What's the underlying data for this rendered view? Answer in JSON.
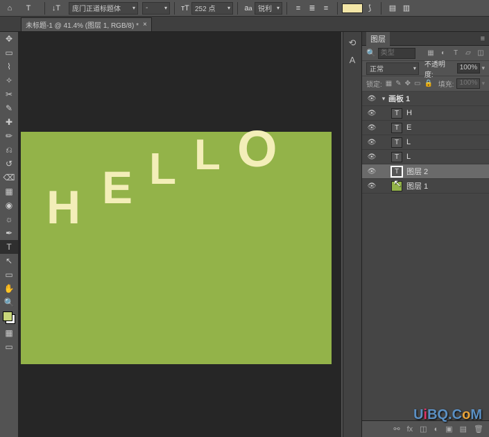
{
  "options": {
    "font_family": "庞门正道标题体",
    "font_style": "-",
    "font_size_label": "tT",
    "font_size": "252 点",
    "aa": "锐利",
    "align": [
      "left",
      "center",
      "right"
    ],
    "swatch_color": "#f3e6a7"
  },
  "tab": {
    "title": "未标题-1 @ 41.4% (图层 1, RGB/8) *"
  },
  "tools": [
    {
      "name": "move-tool",
      "glyph": "✥"
    },
    {
      "name": "marquee-tool",
      "glyph": "▭"
    },
    {
      "name": "lasso-tool",
      "glyph": "⌇"
    },
    {
      "name": "wand-tool",
      "glyph": "✧"
    },
    {
      "name": "crop-tool",
      "glyph": "✂"
    },
    {
      "name": "eyedropper-tool",
      "glyph": "✎"
    },
    {
      "name": "heal-tool",
      "glyph": "✚"
    },
    {
      "name": "brush-tool",
      "glyph": "✏"
    },
    {
      "name": "stamp-tool",
      "glyph": "⎌"
    },
    {
      "name": "history-brush-tool",
      "glyph": "↺"
    },
    {
      "name": "eraser-tool",
      "glyph": "⌫"
    },
    {
      "name": "gradient-tool",
      "glyph": "▦"
    },
    {
      "name": "blur-tool",
      "glyph": "◉"
    },
    {
      "name": "dodge-tool",
      "glyph": "☼"
    },
    {
      "name": "pen-tool",
      "glyph": "✒"
    },
    {
      "name": "type-tool",
      "glyph": "T",
      "active": true
    },
    {
      "name": "path-tool",
      "glyph": "↖"
    },
    {
      "name": "shape-tool",
      "glyph": "▭"
    },
    {
      "name": "hand-tool",
      "glyph": "✋"
    },
    {
      "name": "zoom-tool",
      "glyph": "🔍"
    }
  ],
  "canvas": {
    "letters": {
      "h": "H",
      "e": "E",
      "l1": "L",
      "l2": "L",
      "o": "O"
    }
  },
  "panel": {
    "tab_label": "图层",
    "search_placeholder": "类型",
    "blend_mode": "正常",
    "opacity_label": "不透明度:",
    "opacity_value": "100%",
    "lock_label": "锁定:",
    "fill_label": "填充:",
    "fill_value": "100%",
    "layers": [
      {
        "eye": "●",
        "type": "artboard",
        "name": "画板 1",
        "indent": 0,
        "twist": "▾",
        "bold": true
      },
      {
        "eye": "●",
        "type": "text",
        "name": "H",
        "indent": 1
      },
      {
        "eye": "●",
        "type": "text",
        "name": "E",
        "indent": 1
      },
      {
        "eye": "●",
        "type": "text",
        "name": "L",
        "indent": 1
      },
      {
        "eye": "●",
        "type": "text",
        "name": "L",
        "indent": 1
      },
      {
        "eye": "●",
        "type": "text",
        "name": "图层 2",
        "indent": 1,
        "selected": true
      },
      {
        "eye": "●",
        "type": "pixel",
        "name": "图层 1",
        "indent": 1
      }
    ]
  },
  "watermark": {
    "text": "UiBQ.CoM"
  }
}
